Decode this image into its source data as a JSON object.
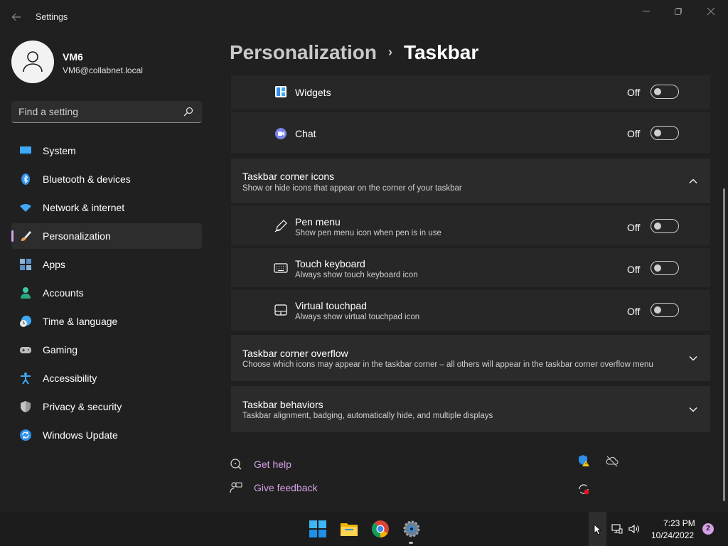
{
  "window": {
    "title": "Settings"
  },
  "profile": {
    "name": "VM6",
    "email": "VM6@collabnet.local"
  },
  "search": {
    "placeholder": "Find a setting"
  },
  "nav": {
    "items": [
      {
        "label": "System",
        "icon": "monitor-icon"
      },
      {
        "label": "Bluetooth & devices",
        "icon": "bluetooth-icon"
      },
      {
        "label": "Network & internet",
        "icon": "wifi-icon"
      },
      {
        "label": "Personalization",
        "icon": "brush-icon",
        "active": true
      },
      {
        "label": "Apps",
        "icon": "apps-icon"
      },
      {
        "label": "Accounts",
        "icon": "person-icon"
      },
      {
        "label": "Time & language",
        "icon": "clock-globe-icon"
      },
      {
        "label": "Gaming",
        "icon": "gamepad-icon"
      },
      {
        "label": "Accessibility",
        "icon": "accessibility-icon"
      },
      {
        "label": "Privacy & security",
        "icon": "shield-icon"
      },
      {
        "label": "Windows Update",
        "icon": "update-icon"
      }
    ]
  },
  "breadcrumb": {
    "parent": "Personalization",
    "separator": "›",
    "current": "Taskbar"
  },
  "taskbar_items": {
    "widgets": {
      "label": "Widgets",
      "state": "Off"
    },
    "chat": {
      "label": "Chat",
      "state": "Off"
    }
  },
  "corner_icons": {
    "title": "Taskbar corner icons",
    "description": "Show or hide icons that appear on the corner of your taskbar",
    "pen": {
      "label": "Pen menu",
      "description": "Show pen menu icon when pen is in use",
      "state": "Off"
    },
    "keyboard": {
      "label": "Touch keyboard",
      "description": "Always show touch keyboard icon",
      "state": "Off"
    },
    "touchpad": {
      "label": "Virtual touchpad",
      "description": "Always show virtual touchpad icon",
      "state": "Off"
    }
  },
  "corner_overflow": {
    "title": "Taskbar corner overflow",
    "description": "Choose which icons may appear in the taskbar corner – all others will appear in the taskbar corner overflow menu"
  },
  "behaviors": {
    "title": "Taskbar behaviors",
    "description": "Taskbar alignment, badging, automatically hide, and multiple displays"
  },
  "links": {
    "help": "Get help",
    "feedback": "Give feedback"
  },
  "taskbar": {
    "apps": [
      "start-icon",
      "file-explorer-icon",
      "chrome-icon",
      "settings-icon"
    ],
    "time": "7:23 PM",
    "date": "10/24/2022",
    "notifications": "2"
  },
  "colors": {
    "accent": "#d6a0e6",
    "background": "#202020",
    "card": "#2b2b2b"
  }
}
